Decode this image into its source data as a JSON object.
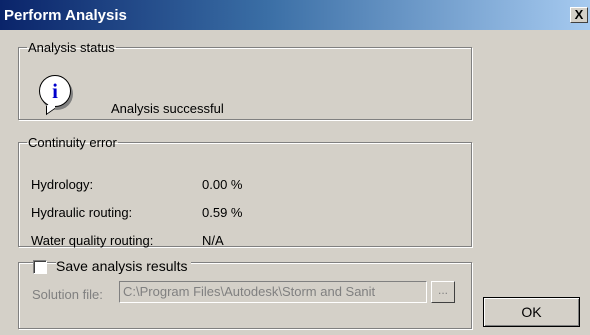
{
  "window": {
    "title": "Perform Analysis",
    "close_label": "X"
  },
  "status": {
    "legend": "Analysis status",
    "icon": "info-icon",
    "icon_glyph": "i",
    "message": "Analysis successful"
  },
  "continuity": {
    "legend": "Continuity error",
    "rows": [
      {
        "label": "Hydrology:",
        "value": "0.00 %"
      },
      {
        "label": "Hydraulic routing:",
        "value": "0.59 %"
      },
      {
        "label": "Water quality routing:",
        "value": "N/A"
      }
    ]
  },
  "save": {
    "checkbox_label": "Save analysis results",
    "checked": false,
    "solution_label": "Solution file:",
    "solution_value": "C:\\Program Files\\Autodesk\\Storm and Sanit",
    "browse_label": "..."
  },
  "ok_label": "OK"
}
